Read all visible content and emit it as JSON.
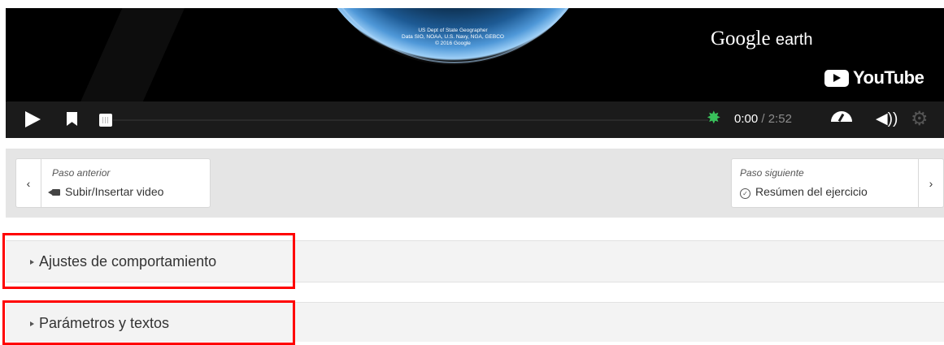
{
  "video": {
    "credits": [
      "US Dept of State Geographer",
      "Data SIO, NOAA, U.S. Navy, NGA, GEBCO",
      "© 2016 Google"
    ],
    "watermark_google": "Google",
    "watermark_earth": "earth",
    "youtube_label": "YouTube",
    "controls": {
      "time_current": "0:00",
      "time_separator": " / ",
      "time_total": "2:52"
    }
  },
  "steps": {
    "previous": {
      "caption": "Paso anterior",
      "title": "Subir/Insertar video",
      "icon": "video-camera-icon"
    },
    "next": {
      "caption": "Paso siguiente",
      "title": "Resúmen del ejercicio",
      "icon": "circle-check-icon"
    }
  },
  "sections": [
    {
      "label": "Ajustes de comportamiento"
    },
    {
      "label": "Parámetros y textos"
    }
  ],
  "colors": {
    "highlight": "#ff0000",
    "progress_star": "#39c05b",
    "control_bar": "#1b1b1b"
  }
}
